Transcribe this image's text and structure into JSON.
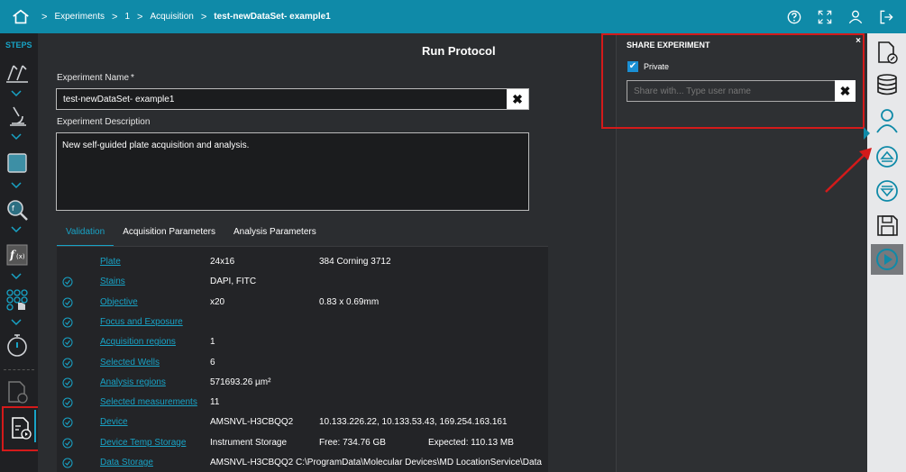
{
  "breadcrumb": [
    "Experiments",
    "1",
    "Acquisition",
    "test-newDataSet- example1"
  ],
  "sidebar": {
    "label": "STEPS"
  },
  "main": {
    "title": "Run Protocol",
    "name_label": "Experiment Name",
    "required_mark": "*",
    "name_value": "test-newDataSet- example1",
    "desc_label": "Experiment Description",
    "desc_value": "New self-guided plate acquisition and analysis.",
    "clear_glyph": "✖"
  },
  "tabs": [
    "Validation",
    "Acquisition Parameters",
    "Analysis Parameters"
  ],
  "validation": [
    {
      "label": "Plate",
      "value": "24x16",
      "extra": "384 Corning 3712",
      "extra2": "",
      "check": false
    },
    {
      "label": "Stains",
      "value": "DAPI, FITC",
      "extra": "",
      "extra2": "",
      "check": true
    },
    {
      "label": "Objective",
      "value": "x20",
      "extra": "0.83 x 0.69mm",
      "extra2": "",
      "check": true
    },
    {
      "label": "Focus and Exposure",
      "value": "",
      "extra": "",
      "extra2": "",
      "check": true
    },
    {
      "label": "Acquisition regions",
      "value": "1",
      "extra": "",
      "extra2": "",
      "check": true
    },
    {
      "label": "Selected Wells",
      "value": "6",
      "extra": "",
      "extra2": "",
      "check": true
    },
    {
      "label": "Analysis regions",
      "value": "571693.26 µm²",
      "extra": "",
      "extra2": "",
      "check": true
    },
    {
      "label": "Selected measurements",
      "value": "11",
      "extra": "",
      "extra2": "",
      "check": true
    },
    {
      "label": "Device",
      "value": "AMSNVL-H3CBQQ2",
      "extra": "10.133.226.22,   10.133.53.43,   169.254.163.161",
      "extra2": "",
      "check": true
    },
    {
      "label": "Device Temp Storage",
      "value": "Instrument Storage",
      "extra": "Free: 734.76 GB",
      "extra2": "Expected: 110.13 MB",
      "check": true
    },
    {
      "label": "Data Storage",
      "value": "AMSNVL-H3CBQQ2 C:\\ProgramData\\Molecular Devices\\MD LocationService\\Data",
      "extra": "",
      "extra2": "",
      "check": true
    }
  ],
  "share": {
    "title": "SHARE EXPERIMENT",
    "close": "×",
    "private_label": "Private",
    "private_checked": true,
    "input_placeholder": "Share with... Type user name",
    "clear_glyph": "✖"
  },
  "colors": {
    "accent": "#0f8aa8",
    "link": "#18a3c6",
    "highlight": "#d41a1a"
  }
}
